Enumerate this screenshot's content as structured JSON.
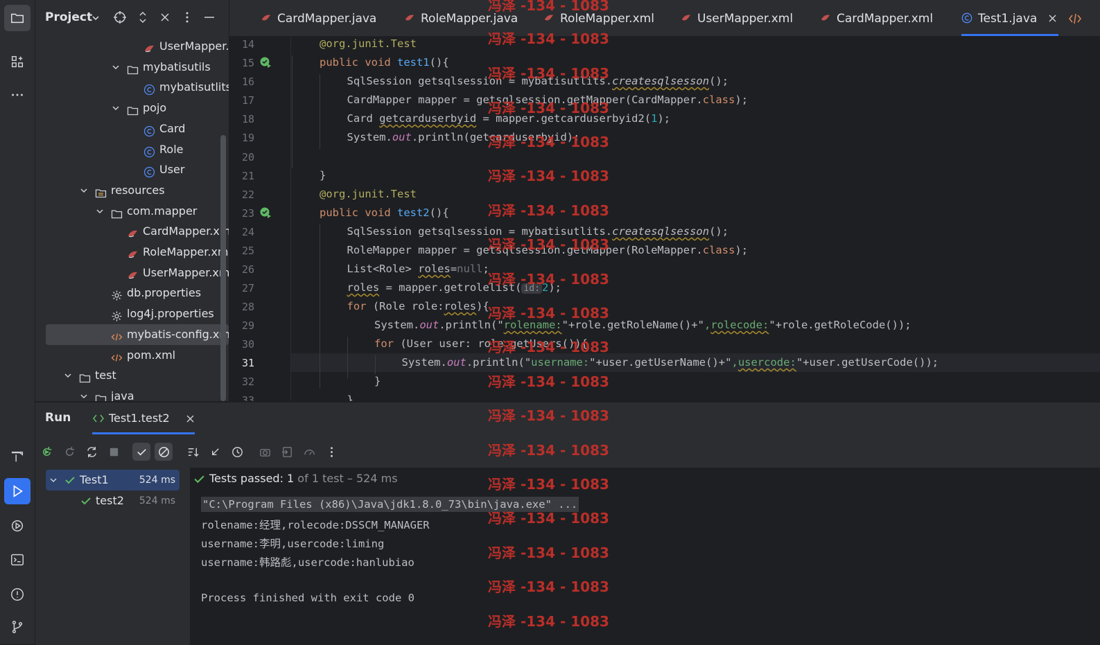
{
  "project": {
    "title": "Project",
    "tree": [
      {
        "label": "UserMapper.java",
        "type": "mapper",
        "indent": 180
      },
      {
        "label": "mybatisutils",
        "type": "folder",
        "indent": 156,
        "open": true
      },
      {
        "label": "mybatisutlits",
        "type": "class",
        "indent": 180
      },
      {
        "label": "pojo",
        "type": "folder",
        "indent": 156,
        "open": true
      },
      {
        "label": "Card",
        "type": "class",
        "indent": 180
      },
      {
        "label": "Role",
        "type": "class",
        "indent": 180
      },
      {
        "label": "User",
        "type": "class",
        "indent": 180
      },
      {
        "label": "resources",
        "type": "resfolder",
        "indent": 110,
        "open": true
      },
      {
        "label": "com.mapper",
        "type": "folder",
        "indent": 133,
        "open": true
      },
      {
        "label": "CardMapper.xml",
        "type": "mapper",
        "indent": 156
      },
      {
        "label": "RoleMapper.xml",
        "type": "mapper",
        "indent": 156
      },
      {
        "label": "UserMapper.xml",
        "type": "mapper",
        "indent": 156
      },
      {
        "label": "db.properties",
        "type": "gear",
        "indent": 133
      },
      {
        "label": "log4j.properties",
        "type": "gear",
        "indent": 133
      },
      {
        "label": "mybatis-config.xml",
        "type": "xml",
        "indent": 133,
        "selected": true
      },
      {
        "label": "pom.xml",
        "type": "xml",
        "indent": 133
      },
      {
        "label": "test",
        "type": "folder",
        "indent": 87,
        "open": true
      },
      {
        "label": "java",
        "type": "folder",
        "indent": 110,
        "open": true
      }
    ]
  },
  "tabs": [
    {
      "label": "CardMapper.java",
      "type": "mapper"
    },
    {
      "label": "RoleMapper.java",
      "type": "mapper"
    },
    {
      "label": "RoleMapper.xml",
      "type": "mapper"
    },
    {
      "label": "UserMapper.xml",
      "type": "mapper"
    },
    {
      "label": "CardMapper.xml",
      "type": "mapper"
    },
    {
      "label": "Test1.java",
      "type": "class",
      "active": true
    }
  ],
  "editor": {
    "line_numbers": [
      "14",
      "15",
      "16",
      "17",
      "18",
      "19",
      "20",
      "21",
      "22",
      "23",
      "24",
      "25",
      "26",
      "27",
      "28",
      "29",
      "30",
      "31",
      "32",
      "33"
    ],
    "current_line": "31"
  },
  "code": {
    "l14": {
      "ann": "@org.junit.",
      "ann2": "Test"
    },
    "l15": {
      "kw": "public void ",
      "fn": "test1",
      "rest": "(){"
    },
    "l16": {
      "a": "SqlSession getsqlsession = mybatisutlits.",
      "m": "createsqlsesson",
      "b": "();"
    },
    "l17": {
      "a": "CardMapper mapper = getsqlsession.getMapper(CardMapper.",
      "kw": "class",
      "b": ");"
    },
    "l18": {
      "a": "Card ",
      "v": "getcarduserbyid",
      "b": " = mapper.getcarduserbyid2(",
      "n": "1",
      "c": ");"
    },
    "l19": {
      "a": "System.",
      "o": "out",
      "b": ".println(getcarduserbyid);"
    },
    "l21": {
      "a": "}"
    },
    "l22": {
      "ann": "@org.junit.",
      "ann2": "Test"
    },
    "l23": {
      "kw": "public void ",
      "fn": "test2",
      "rest": "(){"
    },
    "l24": {
      "a": "SqlSession getsqlsession = mybatisutlits.",
      "m": "createsqlsesson",
      "b": "();"
    },
    "l25": {
      "a": "RoleMapper mapper = getsqlsession.getMapper(RoleMapper.",
      "kw": "class",
      "b": ");"
    },
    "l26": {
      "a": "List<Role> ",
      "v": "roles",
      "b": "=",
      "kw": "null",
      "c": ";"
    },
    "l27": {
      "v": "roles",
      "a": " = mapper.getrolelist(",
      "hint": "id:",
      "n": "2",
      "b": ");"
    },
    "l28": {
      "kw": "for",
      "a": " (Role role:",
      "v": "roles",
      "b": "){"
    },
    "l29": {
      "a": "System.",
      "o": "out",
      "b": ".println(\"",
      "s1": "rolename:",
      "c": "\"+role.getRoleName()+\"",
      ",": ",",
      "s2": "rolecode:",
      "d": "\"+role.getRoleCode());"
    },
    "l30": {
      "kw": "for",
      "a": " (User user: role.getUsers()){"
    },
    "l31": {
      "a": "System.",
      "o": "out",
      "b": ".println(\"",
      "s1": "username:",
      "c": "\"+user.getUserName()+\"",
      ",": ",",
      "s2": "usercode:",
      "d": "\"+user.getUserCode());"
    },
    "l32": {
      "a": "}"
    },
    "l33": {
      "a": "}"
    }
  },
  "watermark": {
    "text": "冯泽 -134 - 1083"
  },
  "run": {
    "title": "Run",
    "config_tab": "Test1.test2",
    "tree": [
      {
        "label": "Test1",
        "time": "524 ms"
      },
      {
        "label": "test2",
        "time": "524 ms"
      }
    ],
    "status": {
      "passed": "Tests passed: 1",
      "detail": " of 1 test – 524 ms"
    },
    "console": [
      "\"C:\\Program Files (x86)\\Java\\jdk1.8.0_73\\bin\\java.exe\" ...",
      "rolename:经理,rolecode:DSSCM_MANAGER",
      "username:李明,usercode:liming",
      "username:韩路彪,usercode:hanlubiao",
      "",
      "Process finished with exit code 0"
    ]
  },
  "colors": {
    "accent": "#3574f0",
    "success": "#5fb865",
    "watermark": "#c3302a"
  }
}
